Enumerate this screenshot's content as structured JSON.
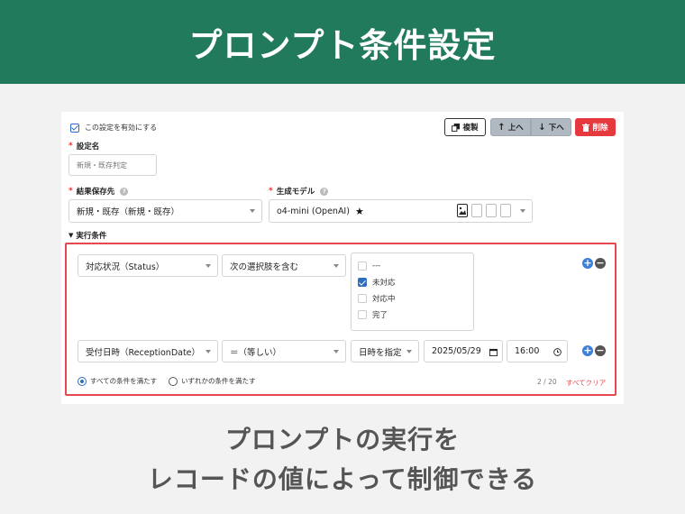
{
  "banner": {
    "title": "プロンプト条件設定"
  },
  "settings": {
    "enable_label": "この設定を有効にする",
    "toolbar": {
      "copy_label": "複製",
      "up_label": "上へ",
      "down_label": "下へ",
      "delete_label": "削除"
    },
    "setting_name": {
      "label": "設定名",
      "required_mark": "*",
      "placeholder": "新規・既存判定"
    },
    "result_destination": {
      "label": "結果保存先",
      "required_mark": "*",
      "value": "新規・既存（新規・既存）"
    },
    "model": {
      "label": "生成モデル",
      "required_mark": "*",
      "value": "o4-mini (OpenAI)"
    },
    "conditions": {
      "section_label": "実行条件",
      "rows": [
        {
          "field": "対応状況（Status）",
          "operator": "次の選択肢を含む",
          "options": [
            {
              "label": "---",
              "checked": false
            },
            {
              "label": "未対応",
              "checked": true
            },
            {
              "label": "対応中",
              "checked": false
            },
            {
              "label": "完了",
              "checked": false
            }
          ]
        },
        {
          "field": "受付日時（ReceptionDate）",
          "operator": "＝（等しい）",
          "mode": "日時を指定",
          "date": "2025/05/29",
          "time": "16:00"
        }
      ],
      "match_all_label": "すべての条件を満たす",
      "match_any_label": "いずれかの条件を満たす",
      "count": "2 / 20",
      "clear_all_label": "すべてクリア"
    }
  },
  "caption": {
    "line1": "プロンプトの実行を",
    "line2": "レコードの値によって制御できる"
  },
  "colors": {
    "banner": "#217a5c",
    "highlight_border": "#e5484d",
    "delete": "#e5393e",
    "accent": "#2f6dbf"
  }
}
